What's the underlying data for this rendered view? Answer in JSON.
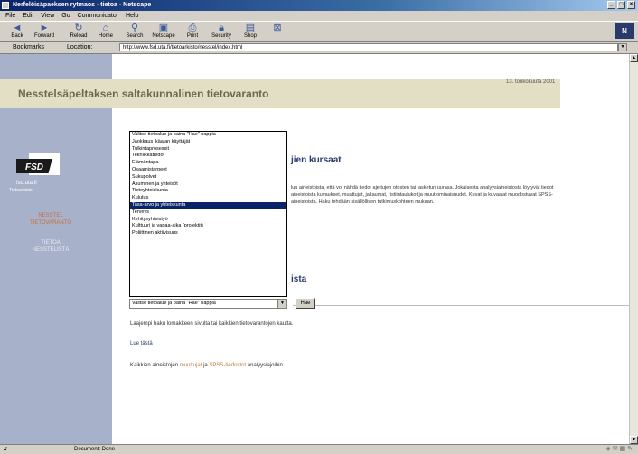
{
  "window": {
    "title": "Nerfelöisäpaeksen rytmaos - tietoa - Netscape"
  },
  "menubar": [
    "File",
    "Edit",
    "View",
    "Go",
    "Communicator",
    "Help"
  ],
  "toolbar": {
    "buttons": [
      {
        "label": "Back",
        "icon": "back-arrow-icon"
      },
      {
        "label": "Forward",
        "icon": "forward-arrow-icon"
      },
      {
        "label": "Reload",
        "icon": "reload-icon"
      },
      {
        "label": "Home",
        "icon": "home-icon"
      },
      {
        "label": "Search",
        "icon": "search-icon"
      },
      {
        "label": "Netscape",
        "icon": "netscape-icon"
      },
      {
        "label": "Print",
        "icon": "print-icon"
      },
      {
        "label": "Security",
        "icon": "security-icon"
      },
      {
        "label": "Shop",
        "icon": "shop-icon"
      },
      {
        "label": "",
        "icon": "stop-icon"
      }
    ]
  },
  "addressbar": {
    "bookmarks_label": "Bookmarks",
    "location_label": "Location:",
    "url": "http://www.fsd.uta.fi/tietoarkisto/nesstel/index.html"
  },
  "page": {
    "date": "13. toukokuuta 2001",
    "banner_title": "Nesstelsäpeltaksen saltakunnalinen tietovaranto",
    "logo_sub1": "fsd.uta.fi",
    "logo_sub2": "Tietoarkisto",
    "nav_active": "NESSTEL\nTIETOVARANTO",
    "nav_other": "TIETOA\nNESSTELISTÄ",
    "section1_title": "jien kursaat",
    "paragraph": "luu aineistoista, että voi nähdä tiedot ajettujen otosten tai lasketun uurasa. Jokaisesta analyysiaineistosta löytyvät tiedot aineistoista kuvaukset, muuttujat, jakaumat, ristiintaulukot ja muut ominaisuudet. Kuvat ja kuvaajat muodostuvat SPSS-aineistoista. Haku tehdään sisällöllisen tutkimuskohteen mukaan.",
    "section2_title": "ista",
    "select_value": "Valitse tietoalue ja paina \"Hae\" nappia",
    "hae_label": "Hae",
    "line1": "Laajempi haku lomakkeen sivulta tai kaikkien tietovarantojen kautta.",
    "line2": "Lue tästä",
    "line3_prefix": "Kaikkien aineistojen",
    "line3_link1": "muuttujat",
    "line3_mid": "ja",
    "line3_link2": "SPSS-tiedostot",
    "line3_suffix": "analyysiajoihin."
  },
  "dropdown": {
    "items": [
      "Valitse tietoalue ja paina \"Hae\" nappia",
      "Jaokkaus ikäajan käyttäjät",
      "Tulkintaprosessit",
      "Tekniikkatiedot",
      "Elämäntapa",
      "Osaamistarpeet",
      "Sukupolvet",
      "Asuminen ja yhteisöt",
      "Tietoyhteiskunta",
      "Kulutus",
      "Tasa-arvo ja yhteiskunta",
      "Terveys",
      "Kehitysyhteistyö",
      "Kulttuuri ja vapaa-aika (projektit)",
      "Poliittinen aktiivisuus"
    ],
    "selected_index": 10,
    "last_item": "..."
  },
  "statusbar": {
    "text": "Document: Done"
  }
}
